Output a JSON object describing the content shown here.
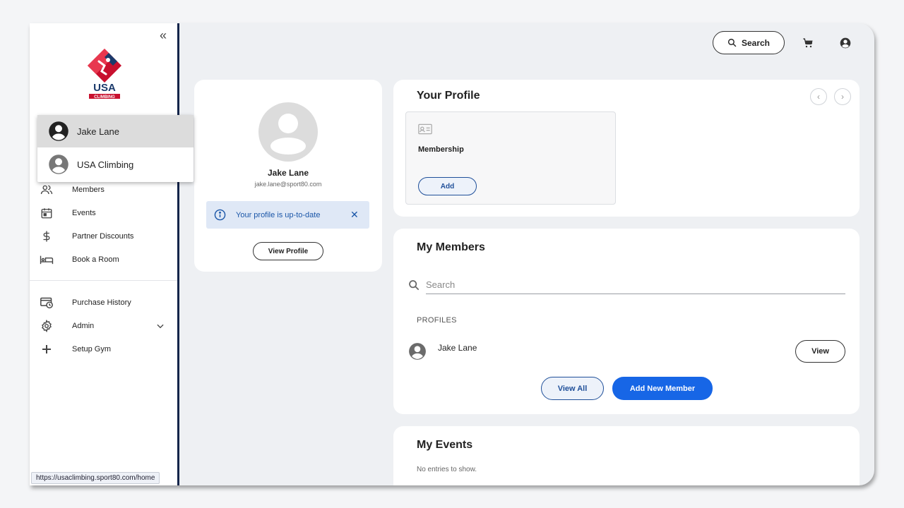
{
  "browser": {
    "status_url": "https://usaclimbing.sport80.com/home"
  },
  "sidebar": {
    "collapse_icon": "double-chevron-left-icon",
    "logo_text": "USA CLIMBING",
    "items": [
      {
        "label": "Members",
        "icon": "people-icon"
      },
      {
        "label": "Events",
        "icon": "calendar-icon"
      },
      {
        "label": "Partner Discounts",
        "icon": "dollar-icon"
      },
      {
        "label": "Book a Room",
        "icon": "bed-icon"
      },
      {
        "label": "Purchase History",
        "icon": "purchase-history-icon"
      },
      {
        "label": "Admin",
        "icon": "gear-icon"
      },
      {
        "label": "Setup Gym",
        "icon": "plus-icon"
      }
    ]
  },
  "account_switcher": {
    "items": [
      {
        "label": "Jake Lane",
        "selected": true
      },
      {
        "label": "USA Climbing",
        "selected": false
      }
    ]
  },
  "header": {
    "search_label": "Search",
    "cart_icon": "cart-icon",
    "account_icon": "account-circle-icon"
  },
  "profile_card": {
    "name": "Jake Lane",
    "email": "jake.lane@sport80.com",
    "alert_text": "Your profile is up-to-date",
    "view_profile_label": "View Profile"
  },
  "your_profile": {
    "title": "Your Profile",
    "membership_label": "Membership",
    "add_label": "Add"
  },
  "my_members": {
    "title": "My Members",
    "search_placeholder": "Search",
    "section_label": "PROFILES",
    "rows": [
      {
        "name": "Jake Lane",
        "action": "View"
      }
    ],
    "view_all_label": "View All",
    "add_new_label": "Add New Member"
  },
  "my_events": {
    "title": "My Events",
    "empty_text": "No entries to show."
  },
  "colors": {
    "primary_blue": "#1766e6",
    "sidebar_rule": "#14254a",
    "alert_bg": "#dfe8f6",
    "alert_text": "#1a56a8"
  }
}
